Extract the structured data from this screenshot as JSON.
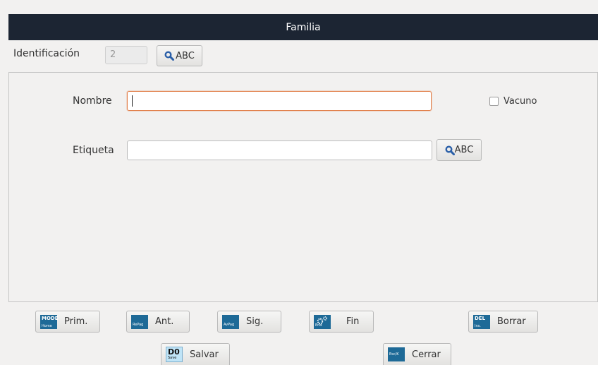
{
  "window": {
    "title": "Familia"
  },
  "header": {
    "id_label": "Identificación",
    "id_value": "2",
    "search_label": "ABC"
  },
  "form": {
    "nombre_label": "Nombre",
    "nombre_value": "",
    "vacuno_label": "Vacuno",
    "vacuno_checked": false,
    "etiqueta_label": "Etiqueta",
    "etiqueta_value": "",
    "etiqueta_search_label": "ABC"
  },
  "nav": {
    "prim": {
      "label": "Prim.",
      "key_top": "MODE",
      "key_bottom": "Home"
    },
    "ant": {
      "label": "Ant.",
      "key": "RePag"
    },
    "sig": {
      "label": "Sig.",
      "key": "AvPag"
    },
    "fin": {
      "label": "Fin",
      "key": "End"
    },
    "borrar": {
      "label": "Borrar",
      "key_top": "DEL",
      "key_bottom": "Ins."
    }
  },
  "actions": {
    "salvar": {
      "label": "Salvar",
      "key": "D0",
      "key_sub": "Save"
    },
    "cerrar": {
      "label": "Cerrar",
      "key": "Esc/K"
    }
  },
  "colors": {
    "titlebar": "#1c2533",
    "focus_border": "#e2824e",
    "key_icon": "#1e6a97",
    "search_icon": "#2a5fa8"
  }
}
